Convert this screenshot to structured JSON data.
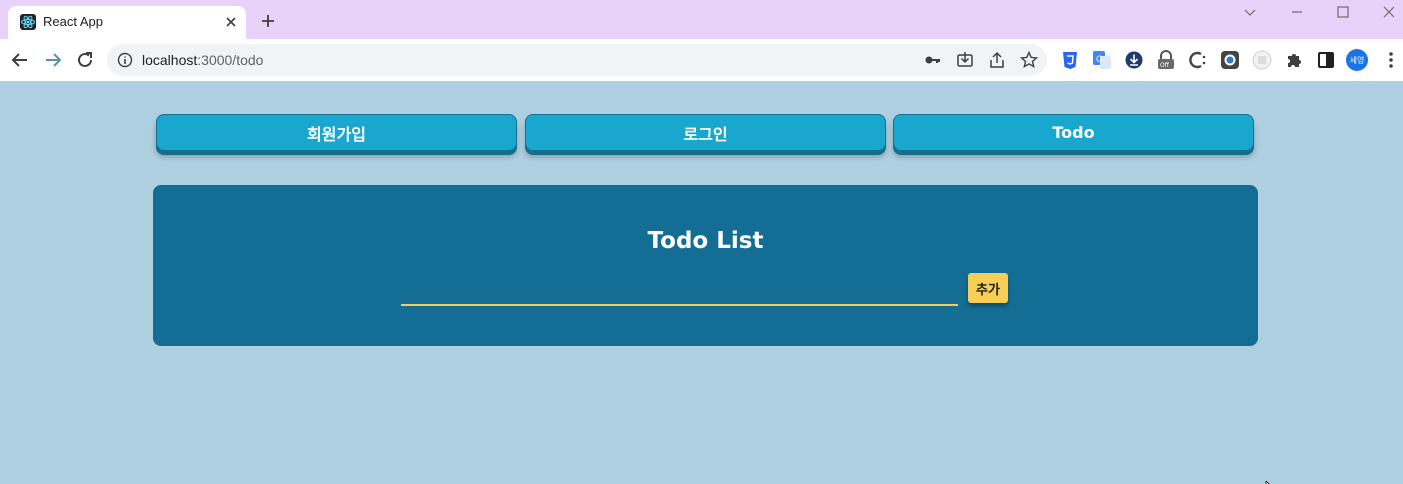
{
  "browser": {
    "tab_title": "React App",
    "url_host": "localhost",
    "url_path": ":3000/todo",
    "profile_initials": "세영",
    "icons": [
      "react-favicon",
      "close-icon",
      "plus-icon",
      "chevron-down-icon",
      "minimize-icon",
      "maximize-icon",
      "window-close-icon",
      "back-icon",
      "forward-icon",
      "reload-icon",
      "info-icon",
      "key-icon",
      "install-icon",
      "share-icon",
      "star-icon",
      "css-extension-icon",
      "translate-extension-icon",
      "download-extension-icon",
      "lock-extension-icon",
      "c-extension-icon",
      "camera-extension-icon",
      "blank-extension-icon",
      "puzzle-icon",
      "side-panel-icon",
      "more-vert-icon"
    ]
  },
  "app": {
    "nav": {
      "signup": "회원가입",
      "login": "로그인",
      "todo": "Todo"
    },
    "todo_panel": {
      "title": "Todo List",
      "input_value": "",
      "input_placeholder": "",
      "add_label": "추가"
    }
  },
  "colors": {
    "page_bg": "#aed0e0",
    "nav_button": "#1aa7cf",
    "panel_bg": "#146d94",
    "accent_yellow": "#f7cf57"
  }
}
